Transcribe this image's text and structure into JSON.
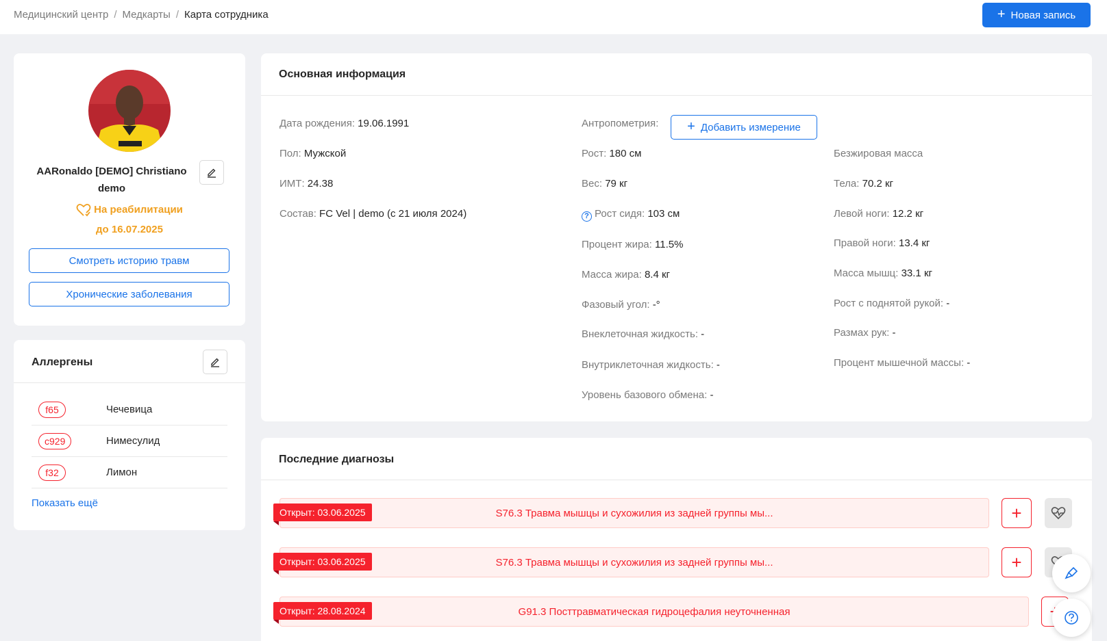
{
  "breadcrumb": {
    "items": [
      "Медицинский центр",
      "Медкарты",
      "Карта сотрудника"
    ],
    "separator": "/"
  },
  "header": {
    "new_record_label": "Новая запись"
  },
  "profile": {
    "name": "AARonaldo [DEMO] Christiano demo",
    "status": "На реабилитации",
    "status_until": "до 16.07.2025",
    "injury_history_label": "Смотреть историю травм",
    "chronic_label": "Хронические заболевания"
  },
  "allergens": {
    "title": "Аллергены",
    "items": [
      {
        "code": "f65",
        "name": "Чечевица"
      },
      {
        "code": "c929",
        "name": "Нимесулид"
      },
      {
        "code": "f32",
        "name": "Лимон"
      }
    ],
    "show_more": "Показать ещё"
  },
  "main_info": {
    "title": "Основная информация",
    "left": [
      {
        "label": "Дата рождения",
        "value": "19.06.1991"
      },
      {
        "label": "Пол",
        "value": "Мужской"
      },
      {
        "label": "ИМТ",
        "value": "24.38"
      },
      {
        "label": "Состав",
        "value": "FC Vel | demo (с 21 июля 2024)"
      }
    ],
    "anthro_label": "Антропометрия",
    "add_measurement_label": "Добавить измерение",
    "mid": [
      {
        "label": "Рост",
        "value": "180 см"
      },
      {
        "label": "Вес",
        "value": "79 кг"
      },
      {
        "label": "Рост сидя",
        "value": "103 см"
      },
      {
        "label": "Процент жира",
        "value": "11.5%"
      },
      {
        "label": "Масса жира",
        "value": "8.4 кг"
      },
      {
        "label": "Фазовый угол",
        "value": "-°"
      },
      {
        "label": "Внеклеточная жидкость",
        "value": "-"
      },
      {
        "label": "Внутриклеточная жидкость",
        "value": "-"
      },
      {
        "label": "Уровень базового обмена",
        "value": "-"
      }
    ],
    "right_heading": "Безжировая масса",
    "right": [
      {
        "label": "Тела",
        "value": "70.2 кг"
      },
      {
        "label": "Левой ноги",
        "value": "12.2 кг"
      },
      {
        "label": "Правой ноги",
        "value": "13.4 кг"
      },
      {
        "label": "Масса мышц",
        "value": "33.1 кг"
      },
      {
        "label": "Рост с поднятой рукой",
        "value": "-"
      },
      {
        "label": "Размах рук",
        "value": "-"
      },
      {
        "label": "Процент мышечной массы",
        "value": "-"
      }
    ]
  },
  "diagnoses": {
    "title": "Последние диагнозы",
    "items": [
      {
        "opened": "Открыт: 03.06.2025",
        "text": "S76.3 Травма мышцы и сухожилия из задней группы мы..."
      },
      {
        "opened": "Открыт: 03.06.2025",
        "text": "S76.3 Травма мышцы и сухожилия из задней группы мы..."
      },
      {
        "opened": "Открыт: 28.08.2024",
        "text": "G91.3 Посттравматическая гидроцефалия неуточненная"
      }
    ]
  },
  "colors": {
    "primary": "#1a73e8",
    "danger": "#f5222d",
    "warning": "#f0a020"
  }
}
